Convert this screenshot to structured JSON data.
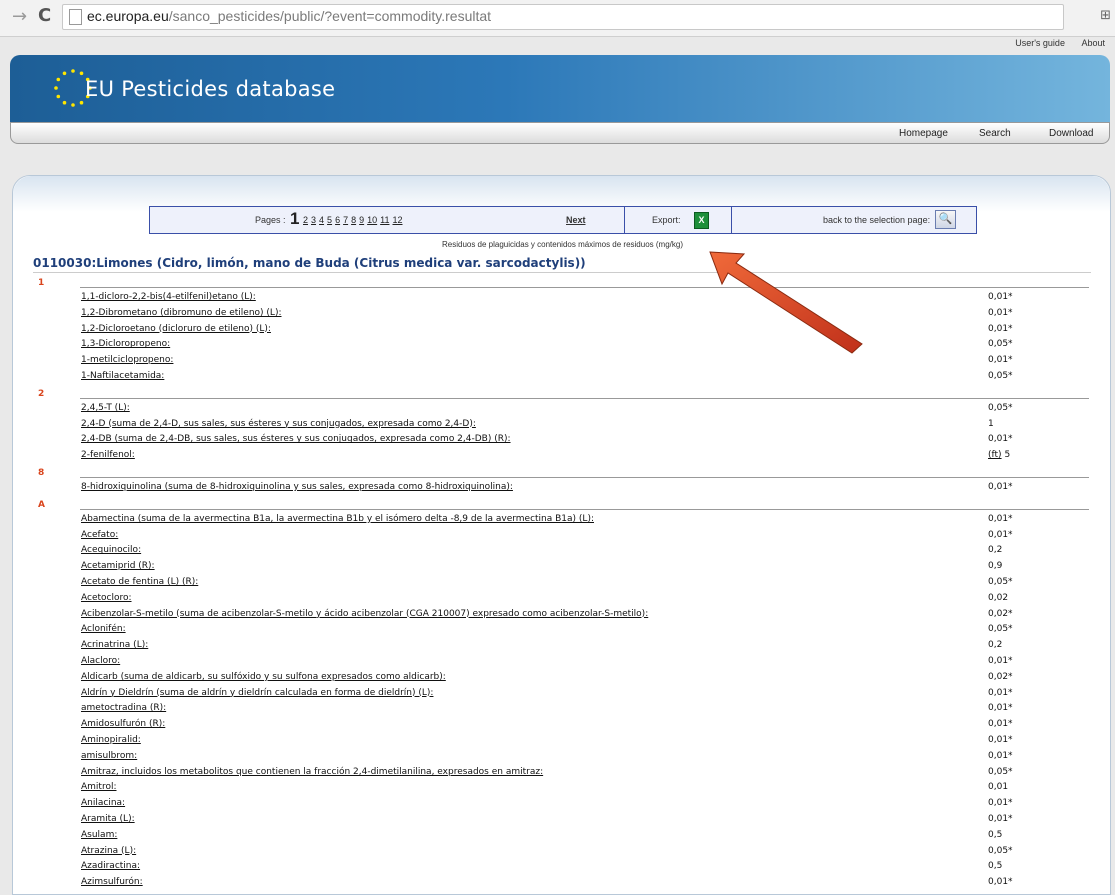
{
  "browser": {
    "url_domain": "ec.europa.eu",
    "url_path": "/sanco_pesticides/public/?event=commodity.resultat"
  },
  "toplinks": [
    "User's guide",
    "About"
  ],
  "header": {
    "title": "EU Pesticides database"
  },
  "nav": [
    "Homepage",
    "Search",
    "Download"
  ],
  "pager": {
    "pages_label": "Pages :",
    "current_page": "1",
    "pages": [
      "2",
      "3",
      "4",
      "5",
      "6",
      "7",
      "8",
      "9",
      "10",
      "11",
      "12"
    ],
    "next_label": "Next",
    "export_label": "Export:",
    "back_label": "back to the selection page:"
  },
  "subtitle": "Residuos de plaguicidas y contenidos máximos de residuos (mg/kg)",
  "commodity": "0110030:Limones (Cidro, limón, mano de Buda (Citrus medica var. sarcodactylis))",
  "groups": [
    {
      "letter": "1",
      "rows": [
        {
          "name": "1,1-dicloro-2,2-bis(4-etilfenil)etano (L):",
          "value": "0,01*"
        },
        {
          "name": "1,2-Dibrometano (dibromuno de etileno) (L):",
          "value": "0,01*"
        },
        {
          "name": "1,2-Dicloroetano (dicloruro de etileno) (L):",
          "value": "0,01*"
        },
        {
          "name": "1,3-Dicloropropeno:",
          "value": "0,05*"
        },
        {
          "name": "1-metilciclopropeno:",
          "value": "0,01*"
        },
        {
          "name": "1-Naftilacetamida:",
          "value": "0,05*"
        }
      ]
    },
    {
      "letter": "2",
      "rows": [
        {
          "name": "2,4,5-T (L):",
          "value": "0,05*"
        },
        {
          "name": "2,4-D (suma de 2,4-D, sus sales, sus ésteres y sus conjugados, expresada como 2,4-D):",
          "value": "1"
        },
        {
          "name": "2,4-DB (suma de 2,4-DB, sus sales, sus ésteres y sus conjugados, expresada como 2,4-DB) (R):",
          "value": "0,01*"
        },
        {
          "name": "2-fenilfenol:",
          "value": "5",
          "flag": "(ft)"
        }
      ]
    },
    {
      "letter": "8",
      "rows": [
        {
          "name": "8-hidroxiquinolina (suma de 8-hidroxiquinolina y sus sales, expresada como 8-hidroxiquinolina):",
          "value": "0,01*"
        }
      ]
    },
    {
      "letter": "A",
      "rows": [
        {
          "name": "Abamectina (suma de la avermectina B1a, la avermectina B1b y el isómero delta -8,9 de la avermectina B1a) (L):",
          "value": "0,01*"
        },
        {
          "name": "Acefato:",
          "value": "0,01*"
        },
        {
          "name": "Acequinocilo:",
          "value": "0,2"
        },
        {
          "name": "Acetamiprid (R):",
          "value": "0,9"
        },
        {
          "name": "Acetato de fentina (L) (R):",
          "value": "0,05*"
        },
        {
          "name": "Acetocloro:",
          "value": "0,02"
        },
        {
          "name": "Acibenzolar-S-metilo (suma de acibenzolar-S-metilo y ácido acibenzolar (CGA 210007) expresado como acibenzolar-S-metilo):",
          "value": "0,02*"
        },
        {
          "name": "Aclonifén:",
          "value": "0,05*"
        },
        {
          "name": "Acrinatrina (L):",
          "value": "0,2"
        },
        {
          "name": "Alacloro:",
          "value": "0,01*"
        },
        {
          "name": "Aldicarb (suma de aldicarb, su sulfóxido y su sulfona expresados como aldicarb):",
          "value": "0,02*"
        },
        {
          "name": "Aldrín y Dieldrín (suma de aldrín y dieldrín calculada en forma de dieldrín) (L):",
          "value": "0,01*"
        },
        {
          "name": "ametoctradina (R):",
          "value": "0,01*"
        },
        {
          "name": "Amidosulfurón (R):",
          "value": "0,01*"
        },
        {
          "name": "Aminopiralid:",
          "value": "0,01*"
        },
        {
          "name": "amisulbrom:",
          "value": "0,01*"
        },
        {
          "name": "Amitraz, incluidos los metabolitos que contienen la fracción 2,4-dimetilanilina, expresados en amitraz:",
          "value": "0,05*"
        },
        {
          "name": "Amitrol:",
          "value": "0,01"
        },
        {
          "name": "Anilacina:",
          "value": "0,01*"
        },
        {
          "name": "Aramita (L):",
          "value": "0,01*"
        },
        {
          "name": "Asulam:",
          "value": "0,5"
        },
        {
          "name": "Atrazina (L):",
          "value": "0,05*"
        },
        {
          "name": "Azadiractina:",
          "value": "0,5"
        },
        {
          "name": "Azimsulfurón:",
          "value": "0,01*"
        }
      ]
    }
  ]
}
